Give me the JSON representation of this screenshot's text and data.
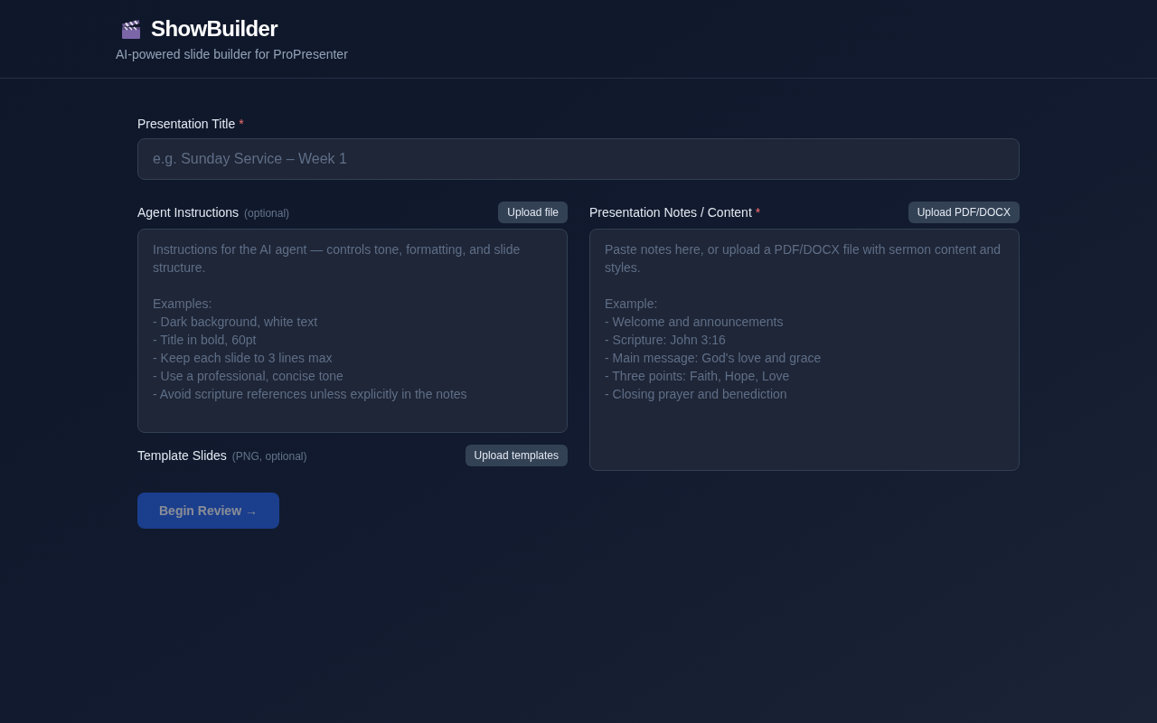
{
  "header": {
    "title": "ShowBuilder",
    "subtitle": "AI-powered slide builder for ProPresenter"
  },
  "form": {
    "title_field": {
      "label": "Presentation Title",
      "required_mark": "*",
      "placeholder": "e.g. Sunday Service – Week 1"
    },
    "agent_instructions": {
      "label": "Agent Instructions",
      "hint": "(optional)",
      "button": "Upload file",
      "placeholder": "Instructions for the AI agent — controls tone, formatting, and slide structure.\n\nExamples:\n- Dark background, white text\n- Title in bold, 60pt\n- Keep each slide to 3 lines max\n- Use a professional, concise tone\n- Avoid scripture references unless explicitly in the notes"
    },
    "template_slides": {
      "label": "Template Slides",
      "hint": "(PNG, optional)",
      "button": "Upload templates"
    },
    "notes": {
      "label": "Presentation Notes / Content",
      "required_mark": "*",
      "button": "Upload PDF/DOCX",
      "placeholder": "Paste notes here, or upload a PDF/DOCX file with sermon content and styles.\n\nExample:\n- Welcome and announcements\n- Scripture: John 3:16\n- Main message: God's love and grace\n- Three points: Faith, Hope, Love\n- Closing prayer and benediction"
    },
    "submit": {
      "label": "Begin Review →",
      "disabled": true
    }
  }
}
